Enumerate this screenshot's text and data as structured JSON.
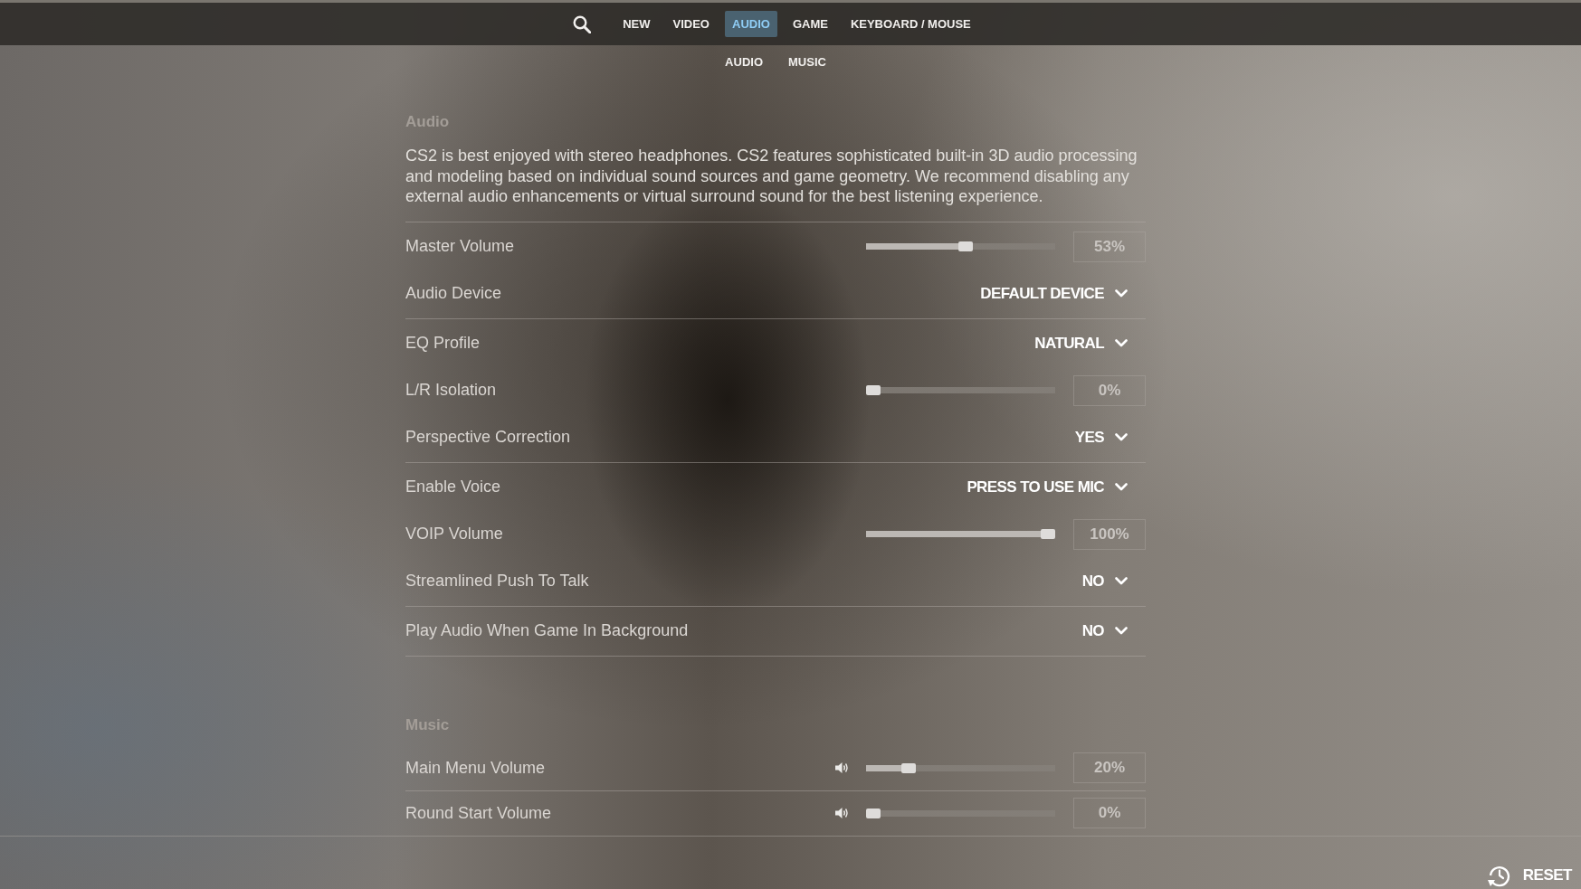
{
  "top_nav": {
    "tabs": [
      {
        "label": "NEW",
        "selected": false
      },
      {
        "label": "VIDEO",
        "selected": false
      },
      {
        "label": "AUDIO",
        "selected": true
      },
      {
        "label": "GAME",
        "selected": false
      },
      {
        "label": "KEYBOARD / MOUSE",
        "selected": false
      }
    ]
  },
  "sub_nav": {
    "links": [
      {
        "label": "AUDIO"
      },
      {
        "label": "MUSIC"
      }
    ]
  },
  "sections": [
    {
      "title": "Audio",
      "description": "CS2 is best enjoyed with stereo headphones. CS2 features sophisticated built-in 3D audio processing and modeling based on individual sound sources and game geometry. We recommend disabling any external audio enhancements or virtual surround sound for the best listening experience.",
      "groups": [
        {
          "rows": [
            {
              "kind": "slider",
              "label": "Master Volume",
              "level": 0.53,
              "reading": "53%"
            },
            {
              "kind": "dropdown",
              "label": "Audio Device",
              "value": "DEFAULT DEVICE"
            }
          ]
        },
        {
          "rows": [
            {
              "kind": "dropdown",
              "label": "EQ Profile",
              "value": "NATURAL"
            },
            {
              "kind": "slider",
              "label": "L/R Isolation",
              "level": 0,
              "reading": "0%"
            },
            {
              "kind": "dropdown",
              "label": "Perspective Correction",
              "value": "YES"
            }
          ]
        },
        {
          "rows": [
            {
              "kind": "dropdown",
              "label": "Enable Voice",
              "value": "PRESS TO USE MIC"
            },
            {
              "kind": "slider",
              "label": "VOIP Volume",
              "level": 1,
              "reading": "100%"
            },
            {
              "kind": "dropdown",
              "label": "Streamlined Push To Talk",
              "value": "NO"
            }
          ]
        },
        {
          "rows": [
            {
              "kind": "dropdown",
              "label": "Play Audio When Game In Background",
              "value": "NO"
            }
          ]
        }
      ]
    },
    {
      "title": "Music",
      "groups": [
        {
          "rows": [
            {
              "kind": "volume_slider",
              "label": "Main Menu Volume",
              "level": 0.2,
              "reading": "20%"
            }
          ]
        },
        {
          "rows": [
            {
              "kind": "volume_slider",
              "label": "Round Start Volume",
              "level": 0,
              "reading": "0%"
            }
          ]
        }
      ]
    }
  ],
  "footer": {
    "reset_label": "RESET"
  }
}
